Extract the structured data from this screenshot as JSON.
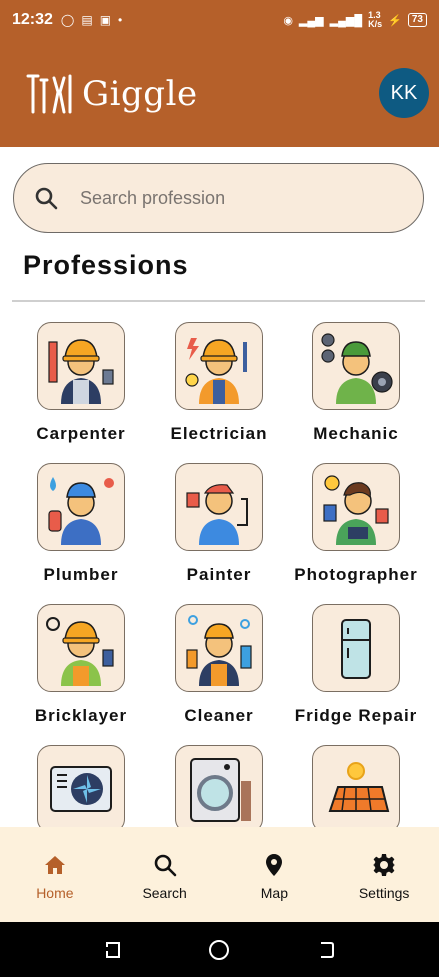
{
  "status": {
    "time": "12:32",
    "net_speed_top": "1.3",
    "net_speed_bottom": "K/s",
    "battery": "73"
  },
  "app": {
    "title": "Giggle",
    "avatar_initials": "KK",
    "brand_color": "#b5602a",
    "avatar_color": "#0e5a82"
  },
  "search": {
    "placeholder": "Search profession"
  },
  "section_title": "Professions",
  "professions": [
    {
      "label": "Carpenter",
      "icon": "carpenter-icon"
    },
    {
      "label": "Electrician",
      "icon": "electrician-icon"
    },
    {
      "label": "Mechanic",
      "icon": "mechanic-icon"
    },
    {
      "label": "Plumber",
      "icon": "plumber-icon"
    },
    {
      "label": "Painter",
      "icon": "painter-icon"
    },
    {
      "label": "Photographer",
      "icon": "photographer-icon"
    },
    {
      "label": "Bricklayer",
      "icon": "bricklayer-icon"
    },
    {
      "label": "Cleaner",
      "icon": "cleaner-icon"
    },
    {
      "label": "Fridge Repair",
      "icon": "fridge-icon"
    },
    {
      "label": "",
      "icon": "ac-repair-icon"
    },
    {
      "label": "",
      "icon": "washing-machine-icon"
    },
    {
      "label": "",
      "icon": "solar-panel-icon"
    }
  ],
  "nav": [
    {
      "label": "Home",
      "icon": "home-icon",
      "active": true
    },
    {
      "label": "Search",
      "icon": "search-icon",
      "active": false
    },
    {
      "label": "Map",
      "icon": "map-pin-icon",
      "active": false
    },
    {
      "label": "Settings",
      "icon": "gear-icon",
      "active": false
    }
  ]
}
